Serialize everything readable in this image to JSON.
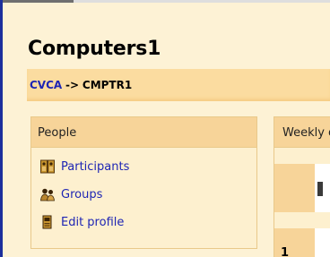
{
  "course": {
    "title": "Computers1"
  },
  "breadcrumb": {
    "root": "CVCA",
    "separator": "->",
    "current": "CMPTR1"
  },
  "people_block": {
    "title": "People",
    "items": [
      {
        "label": "Participants",
        "icon": "participants-icon"
      },
      {
        "label": "Groups",
        "icon": "groups-icon"
      },
      {
        "label": "Edit profile",
        "icon": "edit-profile-icon"
      }
    ]
  },
  "weekly_block": {
    "title": "Weekly outline",
    "week_number": "1"
  },
  "colors": {
    "page_background": "#fdf2d5",
    "header_band": "#f7d499",
    "link": "#1e25b4",
    "frame_border": "#1c2f9c"
  }
}
